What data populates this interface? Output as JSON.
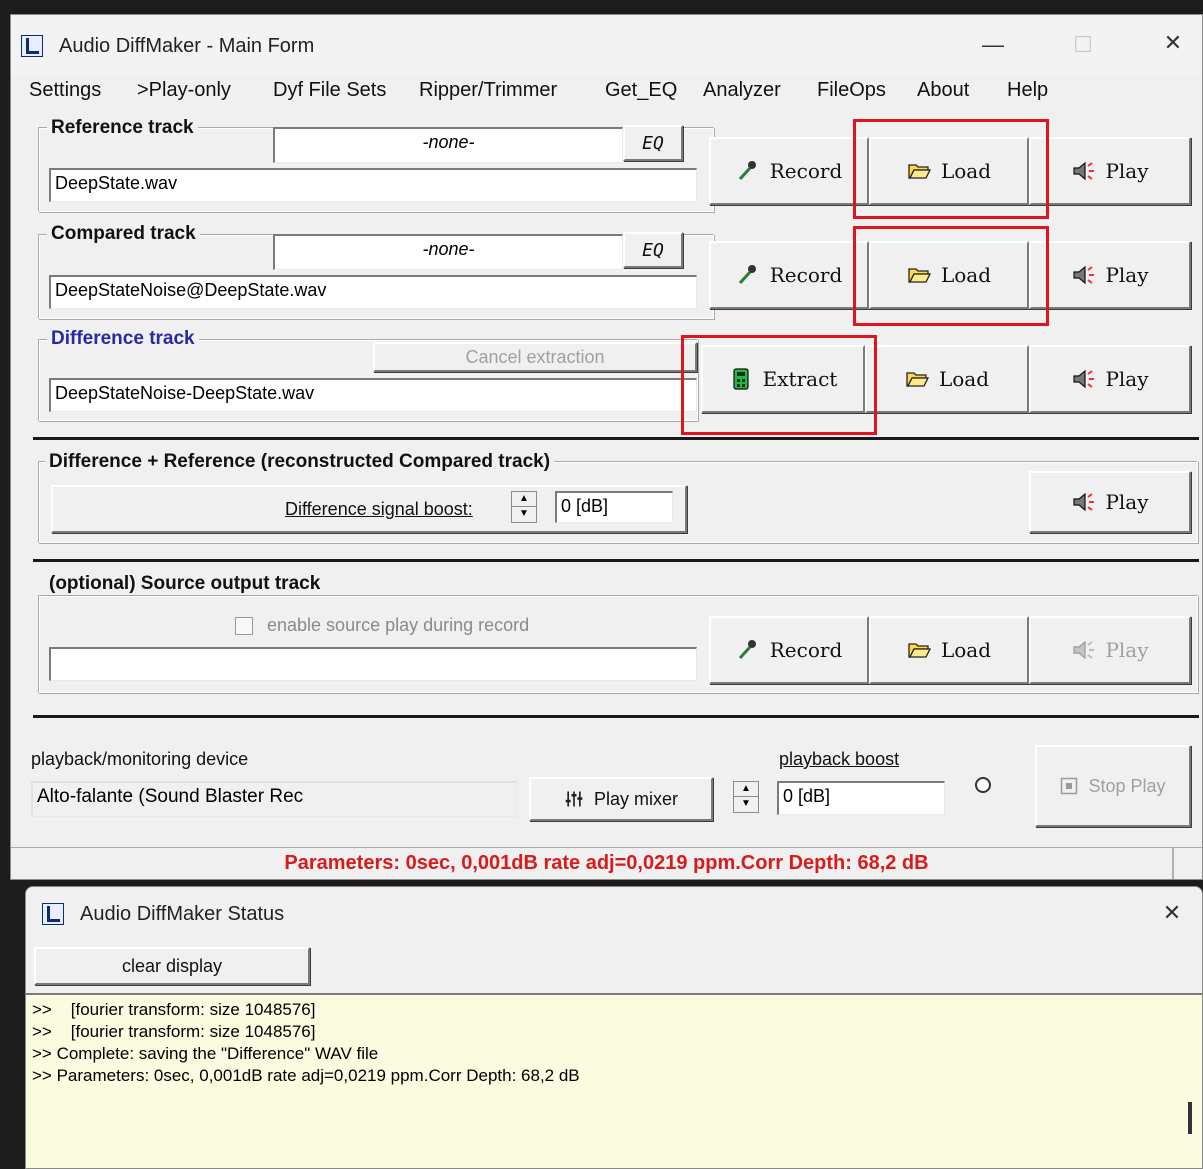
{
  "main_window": {
    "title": "Audio DiffMaker - Main Form",
    "controls": {
      "minimize": "—",
      "maximize": "☐",
      "close": "✕"
    }
  },
  "menu": [
    "Settings",
    ">Play-only",
    "Dyf File Sets",
    "Ripper/Trimmer",
    "Get_EQ",
    "Analyzer",
    "FileOps",
    "About",
    "Help"
  ],
  "reference": {
    "title": "Reference track",
    "eq_value": "-none-",
    "eq_label": "EQ",
    "file": "DeepState.wav",
    "record_label": "Record",
    "load_label": "Load",
    "play_label": "Play"
  },
  "compared": {
    "title": "Compared track",
    "eq_value": "-none-",
    "eq_label": "EQ",
    "file": "DeepStateNoise@DeepState.wav",
    "record_label": "Record",
    "load_label": "Load",
    "play_label": "Play"
  },
  "difference": {
    "title": "Difference track",
    "cancel_label": "Cancel extraction",
    "file": "DeepStateNoise-DeepState.wav",
    "extract_label": "Extract",
    "load_label": "Load",
    "play_label": "Play"
  },
  "diff_plus_ref": {
    "title": "Difference + Reference   (reconstructed Compared track)",
    "boost_label": "Difference signal boost:",
    "boost_value": "0 [dB]",
    "play_label": "Play"
  },
  "source": {
    "title": "(optional) Source output track",
    "checkbox_label": "enable source play during record",
    "file": "",
    "record_label": "Record",
    "load_label": "Load",
    "play_label": "Play"
  },
  "playback": {
    "device_label": "playback/monitoring device",
    "device_value": "Alto-falante (Sound Blaster Rec",
    "mixer_label": "Play mixer",
    "boost_label": "playback boost",
    "boost_value": "0 [dB]",
    "stop_label": "Stop Play"
  },
  "status_bar": {
    "text": "Parameters: 0sec, 0,001dB rate adj=0,0219 ppm.Corr Depth: 68,2 dB"
  },
  "status_window": {
    "title": "Audio DiffMaker Status",
    "close": "✕",
    "clear_label": "clear display",
    "log": [
      ">>    [fourier transform: size 1048576]",
      ">>    [fourier transform: size 1048576]",
      ">> Complete: saving the \"Difference\" WAV file",
      ">> Parameters: 0sec, 0,001dB rate adj=0,0219 ppm.Corr Depth: 68,2 dB"
    ]
  },
  "colors": {
    "highlight_box": "#e0141e",
    "status_text": "#d81c1c",
    "difference_title": "#2a2aa0",
    "log_background": "#fbfbdf"
  },
  "icons": {
    "record": "microphone-icon",
    "load": "folder-open-icon",
    "play": "speaker-icon",
    "extract": "calculator-icon",
    "mixer": "mixer-sliders-icon",
    "stop": "stop-square-icon"
  }
}
